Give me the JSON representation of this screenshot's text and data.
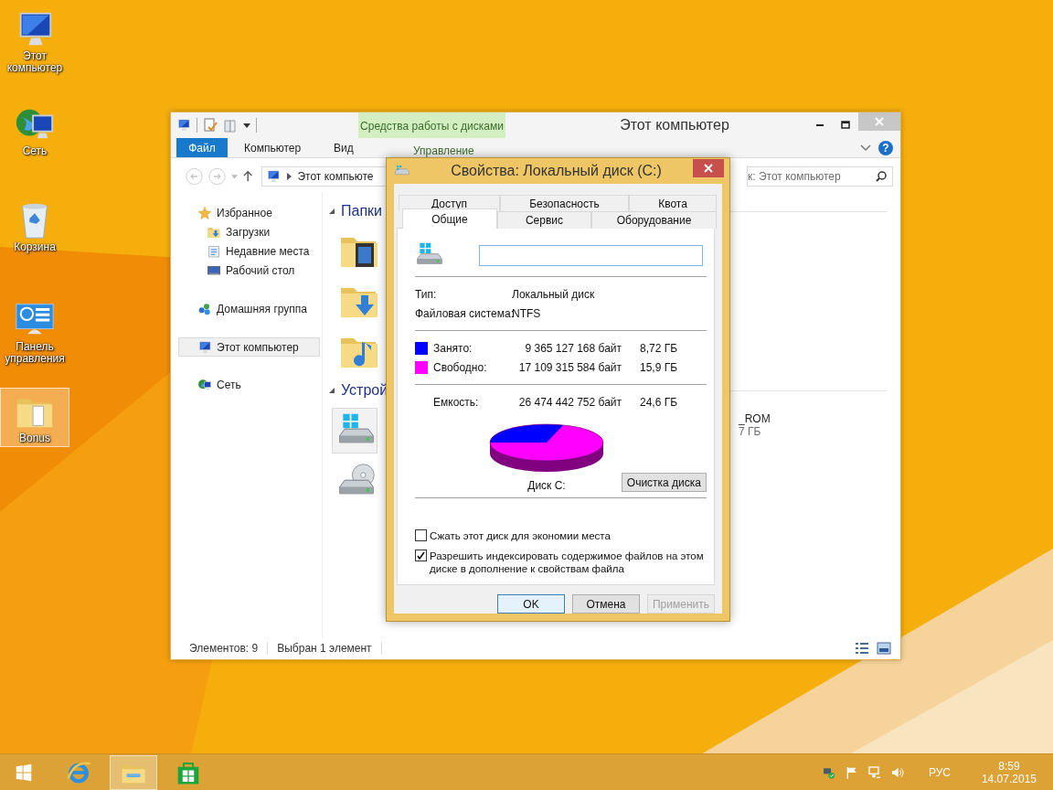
{
  "desktop_icons": [
    {
      "kind": "computer",
      "label": "Этот компьютер",
      "selected": false
    },
    {
      "kind": "network",
      "label": "Сеть",
      "selected": false
    },
    {
      "kind": "recycle-bin",
      "label": "Корзина",
      "selected": false
    },
    {
      "kind": "control-panel",
      "label": "Панель управления",
      "selected": false
    },
    {
      "kind": "folder",
      "label": "Bonus",
      "selected": true
    }
  ],
  "explorer": {
    "title": "Этот компьютер",
    "contextual_group": "Средства работы с дисками",
    "ribbon_tabs": [
      {
        "label": "Файл",
        "kind": "file",
        "selected": false
      },
      {
        "label": "Компьютер",
        "kind": "tab",
        "selected": false
      },
      {
        "label": "Вид",
        "kind": "tab",
        "selected": false
      },
      {
        "label": "Управление",
        "kind": "contextual",
        "selected": false
      }
    ],
    "help_button": "?",
    "address": "Этот компьюте",
    "search": {
      "placeholder": "к: Этот компьютер"
    },
    "nav": [
      {
        "kind": "favorites",
        "label": "Избранное",
        "selected": false,
        "children": [
          {
            "kind": "downloads",
            "label": "Загрузки",
            "selected": false
          },
          {
            "kind": "recent",
            "label": "Недавние места",
            "selected": false
          },
          {
            "kind": "desktop",
            "label": "Рабочий стол",
            "selected": false
          }
        ]
      },
      {
        "kind": "homegroup",
        "label": "Домашняя группа",
        "selected": false
      },
      {
        "kind": "computer",
        "label": "Этот компьютер",
        "selected": true
      },
      {
        "kind": "network",
        "label": "Сеть",
        "selected": false
      }
    ],
    "sections": [
      {
        "kind": "folders",
        "heading": "Папки",
        "items": [
          {
            "kind": "videos"
          },
          {
            "kind": "downloads"
          },
          {
            "kind": "music"
          }
        ]
      },
      {
        "kind": "devices",
        "heading": "Устрой",
        "items": [
          {
            "kind": "system-drive",
            "selected": true
          },
          {
            "kind": "optical-drive",
            "selected": false
          },
          {
            "kind": "covered",
            "selected": false,
            "label": "_ROM",
            "detail": "7 ГБ"
          }
        ]
      }
    ],
    "status": [
      "Элементов: 9",
      "Выбран 1 элемент"
    ]
  },
  "dialog": {
    "title": "Свойства: Локальный диск (C:)",
    "tab_rows": [
      [
        {
          "label": "Доступ",
          "selected": false
        },
        {
          "label": "Безопасность",
          "selected": false
        },
        {
          "label": "Квота",
          "selected": false
        }
      ],
      [
        {
          "label": "Общие",
          "selected": true
        },
        {
          "label": "Сервис",
          "selected": false
        },
        {
          "label": "Оборудование",
          "selected": false
        }
      ]
    ],
    "properties": [
      {
        "label": "Тип:",
        "value": "Локальный диск"
      },
      {
        "label": "Файловая система:",
        "value": "NTFS"
      }
    ],
    "usage": [
      {
        "label": "Занято:",
        "color": "#0000ff",
        "bytes": "9 365 127 168 байт",
        "size": "8,72 ГБ"
      },
      {
        "label": "Свободно:",
        "color": "#ff00ff",
        "bytes": "17 109 315 584 байт",
        "size": "15,9 ГБ"
      }
    ],
    "capacity": {
      "label": "Емкость:",
      "bytes": "26 474 442 752 байт",
      "size": "24,6 ГБ"
    },
    "disk_label": "Диск C:",
    "cleanup_button": "Очистка диска",
    "checkboxes": [
      {
        "label": "Сжать этот диск для экономии места",
        "checked": false
      },
      {
        "label": "Разрешить индексировать содержимое файлов на этом диске в дополнение к свойствам файла",
        "checked": true
      }
    ],
    "buttons": [
      {
        "label": "OK",
        "default": true,
        "disabled": false
      },
      {
        "label": "Отмена",
        "default": false,
        "disabled": false
      },
      {
        "label": "Применить",
        "default": false,
        "disabled": true
      }
    ]
  },
  "taskbar": {
    "apps": [
      {
        "kind": "start",
        "selected": false
      },
      {
        "kind": "browser",
        "selected": false
      },
      {
        "kind": "explorer",
        "selected": true
      },
      {
        "kind": "store",
        "selected": false
      }
    ],
    "tray": [
      {
        "kind": "security"
      },
      {
        "kind": "flag"
      },
      {
        "kind": "network"
      },
      {
        "kind": "volume"
      }
    ],
    "language": "РУС",
    "time": "8:59",
    "date": "14.07.2015"
  }
}
